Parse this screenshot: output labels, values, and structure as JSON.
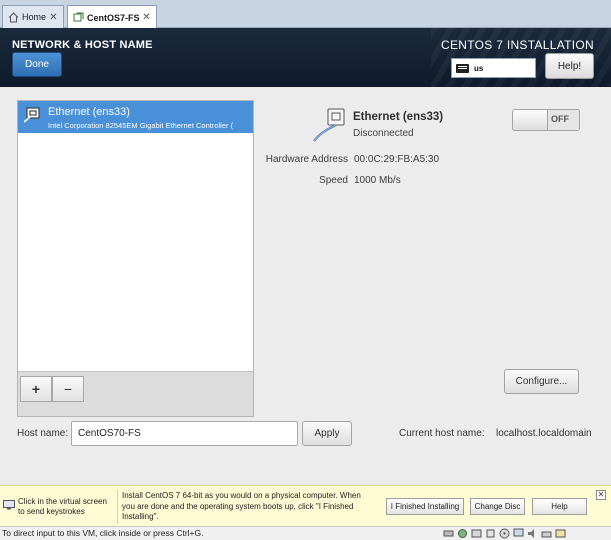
{
  "vm_tabs": [
    {
      "label": "Home",
      "icon": "home-icon"
    },
    {
      "label": "CentOS7-FS",
      "icon": "vm-icon"
    }
  ],
  "header": {
    "spoke_title": "NETWORK & HOST NAME",
    "done_label": "Done",
    "install_title": "CENTOS 7 INSTALLATION",
    "keyboard_layout": "us",
    "help_label": "Help!"
  },
  "devices": [
    {
      "name": "Ethernet (ens33)",
      "description": "Intel Corporation 82545EM Gigabit Ethernet Controller (",
      "selected": true
    }
  ],
  "device_toolbar": {
    "add_label": "+",
    "remove_label": "−"
  },
  "detail": {
    "name": "Ethernet (ens33)",
    "status": "Disconnected",
    "toggle_state": "OFF",
    "hardware_address_label": "Hardware Address",
    "hardware_address": "00:0C:29:FB:A5:30",
    "speed_label": "Speed",
    "speed": "1000 Mb/s",
    "configure_label": "Configure..."
  },
  "hostname": {
    "label": "Host name:",
    "value": "CentOS70-FS",
    "apply_label": "Apply",
    "current_label": "Current host name:",
    "current_value": "localhost.localdomain"
  },
  "vm_hint": {
    "left_text": "Click in the virtual screen to send keystrokes",
    "main_text": "Install CentOS 7 64-bit as you would on a physical computer. When you are done and the operating system boots up, click \"I Finished Installing\".",
    "finished_label": "I Finished Installing",
    "change_disc_label": "Change Disc",
    "help_label": "Help",
    "close_label": "✕"
  },
  "statusbar": {
    "text": "To direct input to this VM, click inside or press Ctrl+G."
  },
  "colors": {
    "header_bg": "#12202f",
    "accent_blue": "#4a90d9",
    "hint_bg": "#fffbd4"
  }
}
